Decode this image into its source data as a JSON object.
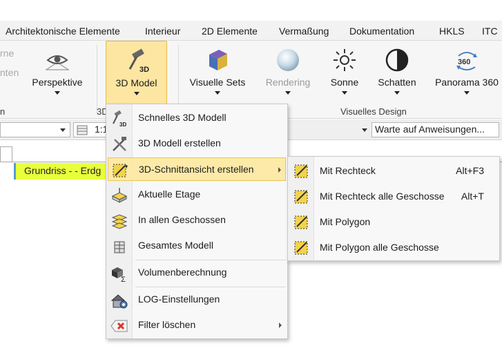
{
  "menubar": {
    "tabs": [
      "Architektonische Elemente",
      "Interieur",
      "2D Elemente",
      "Vermaßung",
      "Dokumentation",
      "HKLS",
      "ITC"
    ]
  },
  "ribbon": {
    "faded_left": [
      "rne",
      "nten"
    ],
    "perspektive": "Perspektive",
    "model3d": "3D Model",
    "visuelle_sets": "Visuelle Sets",
    "rendering": "Rendering",
    "sonne": "Sonne",
    "schatten": "Schatten",
    "panorama": "Panorama 360",
    "group_left_fragment": "n",
    "group_3d_fragment": "3D",
    "group_visuelles_design": "Visuelles Design"
  },
  "toolbar": {
    "scale_fragment": "1:1",
    "status": "Warte auf Anweisungen..."
  },
  "document": {
    "layer_label": "Grundriss -  - Erdg"
  },
  "dropdown": {
    "items": [
      {
        "label": "Schnelles 3D Modell",
        "icon": "quick-3d-model-icon"
      },
      {
        "label": "3D Modell erstellen",
        "icon": "create-3d-model-icon"
      },
      {
        "label": "3D-Schnittansicht erstellen",
        "icon": "section-view-icon"
      },
      {
        "label": "Aktuelle Etage",
        "icon": "current-floor-icon"
      },
      {
        "label": "In allen Geschossen",
        "icon": "all-floors-icon"
      },
      {
        "label": "Gesamtes Modell",
        "icon": "whole-model-icon"
      },
      {
        "label": "Volumenberechnung",
        "icon": "volume-calculation-icon"
      },
      {
        "label": "LOG-Einstellungen",
        "icon": "log-settings-icon"
      },
      {
        "label": "Filter löschen",
        "icon": "delete-filter-icon"
      }
    ]
  },
  "submenu": {
    "items": [
      {
        "label": "Mit Rechteck",
        "shortcut": "Alt+F3"
      },
      {
        "label": "Mit Rechteck alle Geschosse",
        "shortcut": "Alt+T"
      },
      {
        "label": "Mit Polygon",
        "shortcut": ""
      },
      {
        "label": "Mit Polygon alle Geschosse",
        "shortcut": ""
      }
    ]
  },
  "colors": {
    "accent_hover": "#fdeaa8",
    "accent_border": "#eac45c",
    "layer_highlight": "#e8ff3c",
    "delete_red": "#d9342b"
  }
}
